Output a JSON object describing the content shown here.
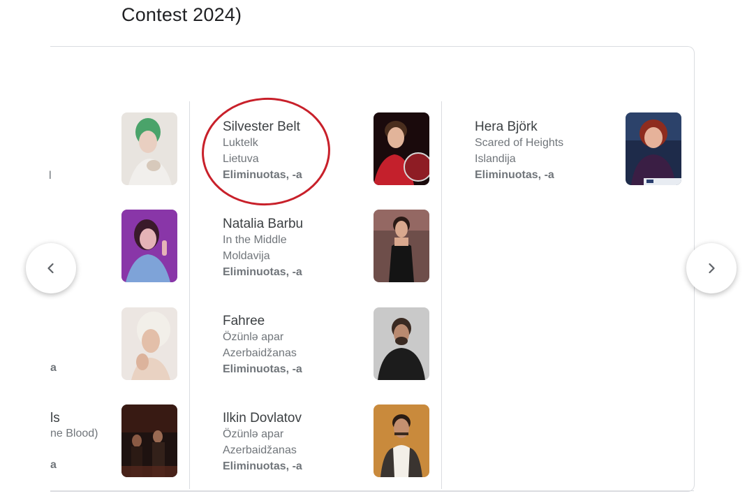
{
  "header": {
    "title": "Contest 2024)"
  },
  "left_fragments": {
    "row1": "l",
    "row3": "a",
    "row4_line1": "ls",
    "row4_line2": "ne Blood)",
    "row4_status": "a"
  },
  "column2": [
    {
      "name": "Silvester Belt",
      "song": "Luktelk",
      "country": "Lietuva",
      "status": "Eliminuotas, -a"
    },
    {
      "name": "Natalia Barbu",
      "song": "In the Middle",
      "country": "Moldavija",
      "status": "Eliminuotas, -a"
    },
    {
      "name": "Fahree",
      "song": "Özünlə apar",
      "country": "Azerbaidžanas",
      "status": "Eliminuotas, -a"
    },
    {
      "name": "Ilkin Dovlatov",
      "song": "Özünlə apar",
      "country": "Azerbaidžanas",
      "status": "Eliminuotas, -a"
    }
  ],
  "column3": [
    {
      "name": "Hera Björk",
      "song": "Scared of Heights",
      "country": "Islandija",
      "status": "Eliminuotas, -a"
    }
  ],
  "nav": {
    "prev_icon": "chevron-left-icon",
    "next_icon": "chevron-right-icon"
  },
  "colors": {
    "annotation": "#c8202a",
    "border": "#dadce0",
    "text_primary": "#3c4043",
    "text_secondary": "#70757a"
  }
}
